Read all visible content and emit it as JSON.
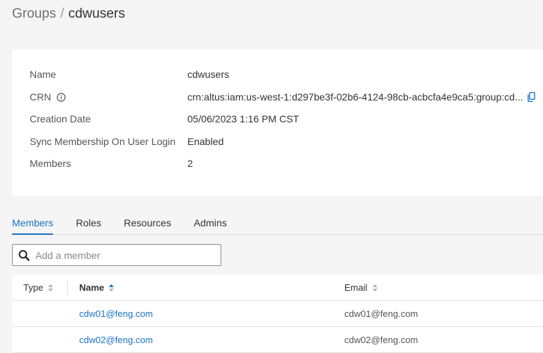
{
  "breadcrumb": {
    "root": "Groups",
    "separator": "/",
    "current": "cdwusers"
  },
  "details": {
    "rows": [
      {
        "label": "Name",
        "value": "cdwusers"
      },
      {
        "label": "CRN",
        "value": "crn:altus:iam:us-west-1:d297be3f-02b6-4124-98cb-acbcfa4e9ca5:group:cd..."
      },
      {
        "label": "Creation Date",
        "value": "05/06/2023 1:16 PM CST"
      },
      {
        "label": "Sync Membership On User Login",
        "value": "Enabled"
      },
      {
        "label": "Members",
        "value": "2"
      }
    ],
    "icons": {
      "crn_info": "info-icon",
      "crn_copy": "copy-icon"
    }
  },
  "tabs": [
    {
      "label": "Members",
      "active": true
    },
    {
      "label": "Roles",
      "active": false
    },
    {
      "label": "Resources",
      "active": false
    },
    {
      "label": "Admins",
      "active": false
    }
  ],
  "search": {
    "placeholder": "Add a member",
    "value": "",
    "icon": "search-icon"
  },
  "table": {
    "columns": [
      {
        "label": "Type",
        "sort": "none"
      },
      {
        "label": "Name",
        "sort": "ascending"
      },
      {
        "label": "Email",
        "sort": "none"
      }
    ],
    "rows": [
      {
        "type": "",
        "name": "cdw01@feng.com",
        "email": "cdw01@feng.com"
      },
      {
        "type": "",
        "name": "cdw02@feng.com",
        "email": "cdw02@feng.com"
      }
    ]
  },
  "colors": {
    "accent": "#1a73c8",
    "background": "#f5f5f5",
    "card": "#ffffff",
    "text": "#333333",
    "muted": "#707070"
  }
}
